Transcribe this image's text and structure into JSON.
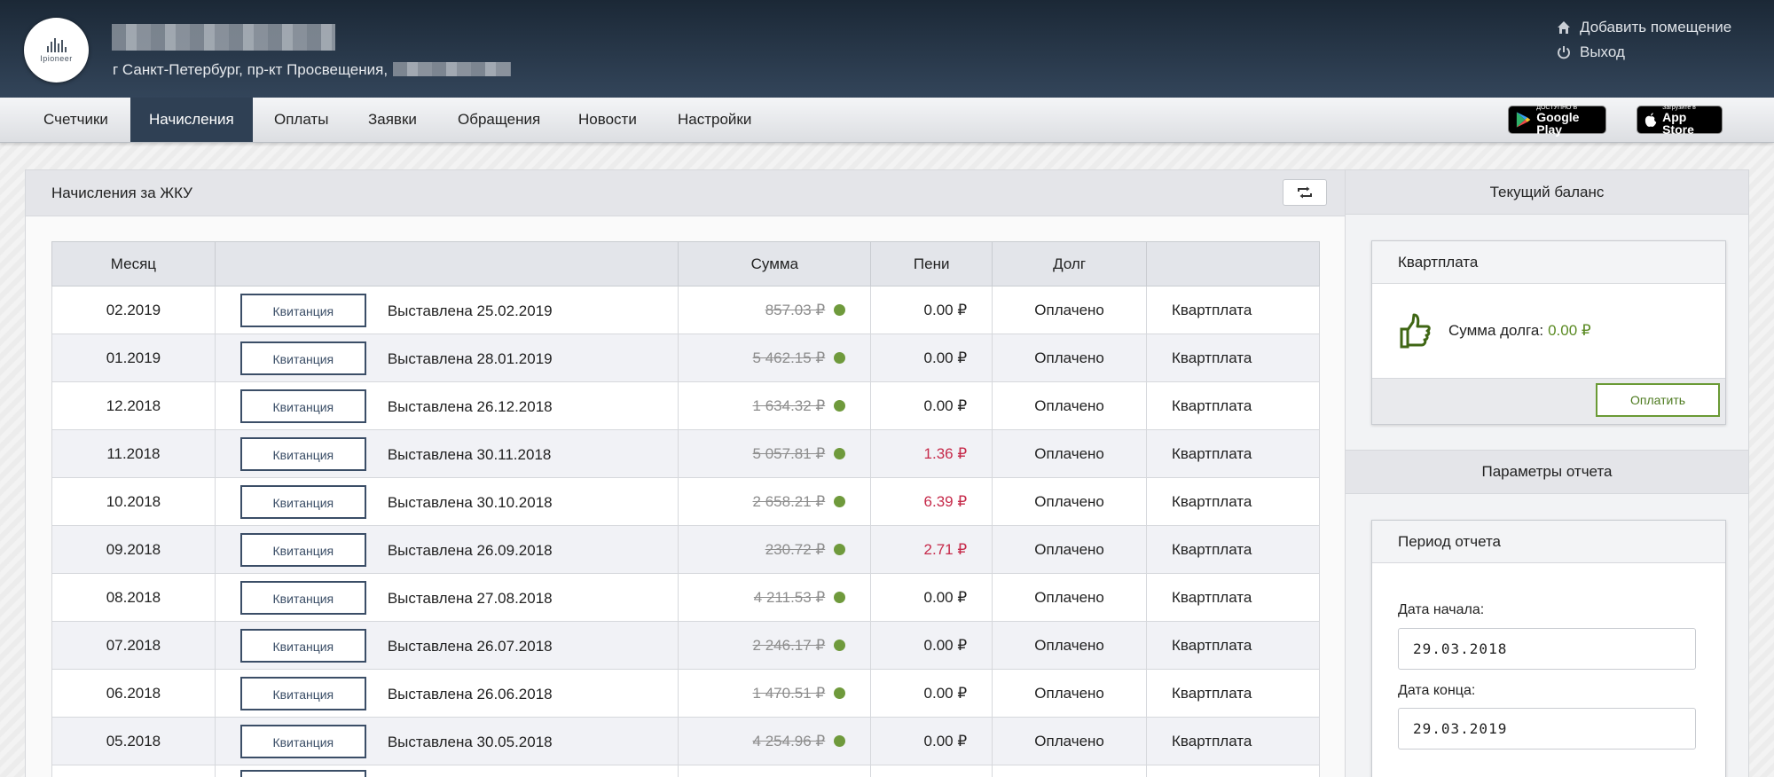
{
  "header": {
    "address": "г Санкт-Петербург, пр-кт Просвещения,",
    "logo_text": "Ipioneer",
    "links": [
      {
        "label": "Добавить помещение",
        "icon": "home-icon"
      },
      {
        "label": "Выход",
        "icon": "power-icon"
      }
    ]
  },
  "nav": {
    "items": [
      "Счетчики",
      "Начисления",
      "Оплаты",
      "Заявки",
      "Обращения",
      "Новости",
      "Настройки"
    ],
    "active": "Начисления",
    "google_play": {
      "small": "ДОСТУПНО В",
      "big": "Google Play"
    },
    "app_store": {
      "small": "Загрузите в",
      "big": "App Store"
    }
  },
  "charges": {
    "title": "Начисления за ЖКУ",
    "columns": [
      "Месяц",
      "",
      "Сумма",
      "Пени",
      "Долг",
      ""
    ],
    "receipt_label": "Квитанция",
    "rows": [
      {
        "month": "02.2019",
        "issued": "Выставлена 25.02.2019",
        "sum": "857.03 ₽",
        "peni": "0.00 ₽",
        "peni_red": false,
        "debt": "Оплачено",
        "kind": "Квартплата"
      },
      {
        "month": "01.2019",
        "issued": "Выставлена 28.01.2019",
        "sum": "5 462.15 ₽",
        "peni": "0.00 ₽",
        "peni_red": false,
        "debt": "Оплачено",
        "kind": "Квартплата"
      },
      {
        "month": "12.2018",
        "issued": "Выставлена 26.12.2018",
        "sum": "1 634.32 ₽",
        "peni": "0.00 ₽",
        "peni_red": false,
        "debt": "Оплачено",
        "kind": "Квартплата"
      },
      {
        "month": "11.2018",
        "issued": "Выставлена 30.11.2018",
        "sum": "5 057.81 ₽",
        "peni": "1.36 ₽",
        "peni_red": true,
        "debt": "Оплачено",
        "kind": "Квартплата"
      },
      {
        "month": "10.2018",
        "issued": "Выставлена 30.10.2018",
        "sum": "2 658.21 ₽",
        "peni": "6.39 ₽",
        "peni_red": true,
        "debt": "Оплачено",
        "kind": "Квартплата"
      },
      {
        "month": "09.2018",
        "issued": "Выставлена 26.09.2018",
        "sum": "230.72 ₽",
        "peni": "2.71 ₽",
        "peni_red": true,
        "debt": "Оплачено",
        "kind": "Квартплата"
      },
      {
        "month": "08.2018",
        "issued": "Выставлена 27.08.2018",
        "sum": "4 211.53 ₽",
        "peni": "0.00 ₽",
        "peni_red": false,
        "debt": "Оплачено",
        "kind": "Квартплата"
      },
      {
        "month": "07.2018",
        "issued": "Выставлена 26.07.2018",
        "sum": "2 246.17 ₽",
        "peni": "0.00 ₽",
        "peni_red": false,
        "debt": "Оплачено",
        "kind": "Квартплата"
      },
      {
        "month": "06.2018",
        "issued": "Выставлена 26.06.2018",
        "sum": "1 470.51 ₽",
        "peni": "0.00 ₽",
        "peni_red": false,
        "debt": "Оплачено",
        "kind": "Квартплата"
      },
      {
        "month": "05.2018",
        "issued": "Выставлена 30.05.2018",
        "sum": "4 254.96 ₽",
        "peni": "0.00 ₽",
        "peni_red": false,
        "debt": "Оплачено",
        "kind": "Квартплата"
      }
    ]
  },
  "balance": {
    "title": "Текущий баланс",
    "card_title": "Квартплата",
    "debt_label": "Сумма долга:",
    "debt_value": "0.00 ₽",
    "pay_label": "Оплатить"
  },
  "report": {
    "title": "Параметры отчета",
    "card_title": "Период отчета",
    "start_label": "Дата начала:",
    "start_value": "29.03.2018",
    "end_label": "Дата конца:",
    "end_value": "29.03.2019"
  },
  "colors": {
    "header_dark": "#1b2836",
    "nav_active": "#2f4054",
    "paid_dot": "#6f9a3c",
    "peni_red": "#c62a4a",
    "debt_green": "#5a8a22"
  }
}
